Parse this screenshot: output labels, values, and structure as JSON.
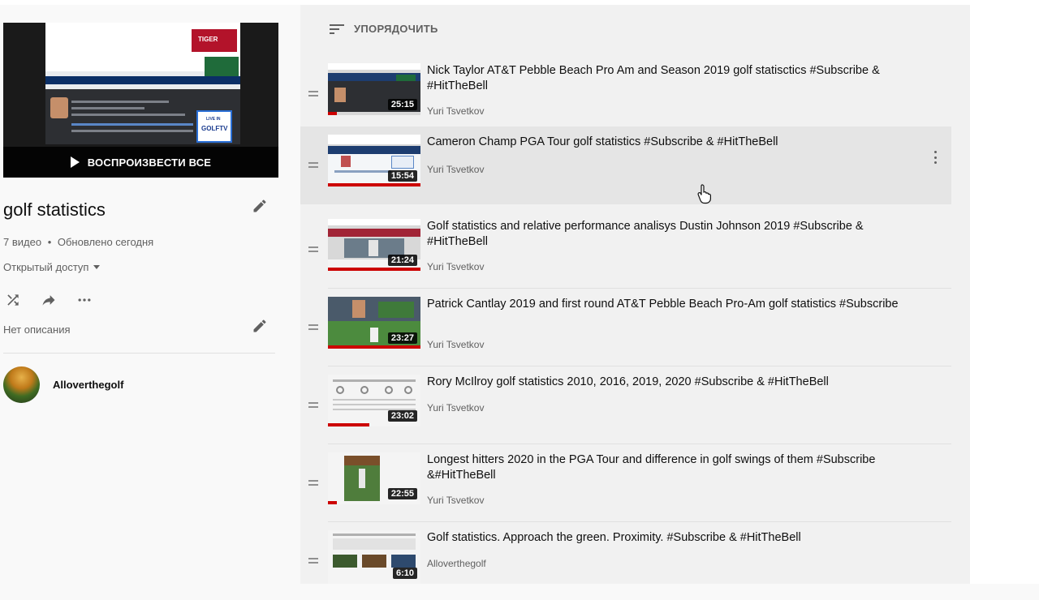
{
  "playlist": {
    "play_all_label": "ВОСПРОИЗВЕСТИ ВСЕ",
    "title": "golf statistics",
    "video_count": "7 видео",
    "meta_separator": "•",
    "updated": "Обновлено сегодня",
    "privacy": "Открытый доступ",
    "description": "Нет описания",
    "owner": "Alloverthegolf",
    "hero_overlay_texts": [
      "TIGER",
      "LIVE IN",
      "GOLFTV"
    ]
  },
  "sort": {
    "label": "УПОРЯДОЧИТЬ"
  },
  "videos": [
    {
      "title": "Nick Taylor AT&T Pebble Beach Pro Am and Season 2019 golf statisctics #Subscribe & #HitTheBell",
      "channel": "Yuri Tsvetkov",
      "duration": "25:15",
      "watched": 0.1
    },
    {
      "title": "Cameron Champ PGA Tour golf statistics #Subscribe & #HitTheBell",
      "channel": "Yuri Tsvetkov",
      "duration": "15:54",
      "watched": 1.0
    },
    {
      "title": "Golf statistics and relative performance analisys Dustin Johnson 2019 #Subscribe & #HitTheBell",
      "channel": "Yuri Tsvetkov",
      "duration": "21:24",
      "watched": 1.0
    },
    {
      "title": "Patrick Cantlay 2019 and first round AT&T Pebble Beach Pro-Am golf statistics #Subscribe",
      "channel": "Yuri Tsvetkov",
      "duration": "23:27",
      "watched": 1.0
    },
    {
      "title": "Rory McIlroy golf statistics 2010, 2016, 2019, 2020 #Subscribe & #HitTheBell",
      "channel": "Yuri Tsvetkov",
      "duration": "23:02",
      "watched": 0.45
    },
    {
      "title": "Longest hitters 2020 in the PGA Tour and difference in golf swings of them #Subscribe &#HitTheBell",
      "channel": "Yuri Tsvetkov",
      "duration": "22:55",
      "watched": 0.1
    },
    {
      "title": "Golf statistics. Approach the green. Proximity. #Subscribe & #HitTheBell",
      "channel": "Alloverthegolf",
      "duration": "6:10",
      "watched": 0.0
    }
  ],
  "colors": {
    "progress": "#cc0000",
    "background": "#f9f9f9",
    "list_background": "#f1f1f1",
    "hover": "#e5e5e5"
  },
  "icons": [
    "play-icon",
    "pencil-icon",
    "shuffle-icon",
    "share-icon",
    "more-horizontal-icon",
    "sort-icon",
    "drag-handle-icon",
    "more-vertical-icon",
    "hand-cursor-icon"
  ]
}
